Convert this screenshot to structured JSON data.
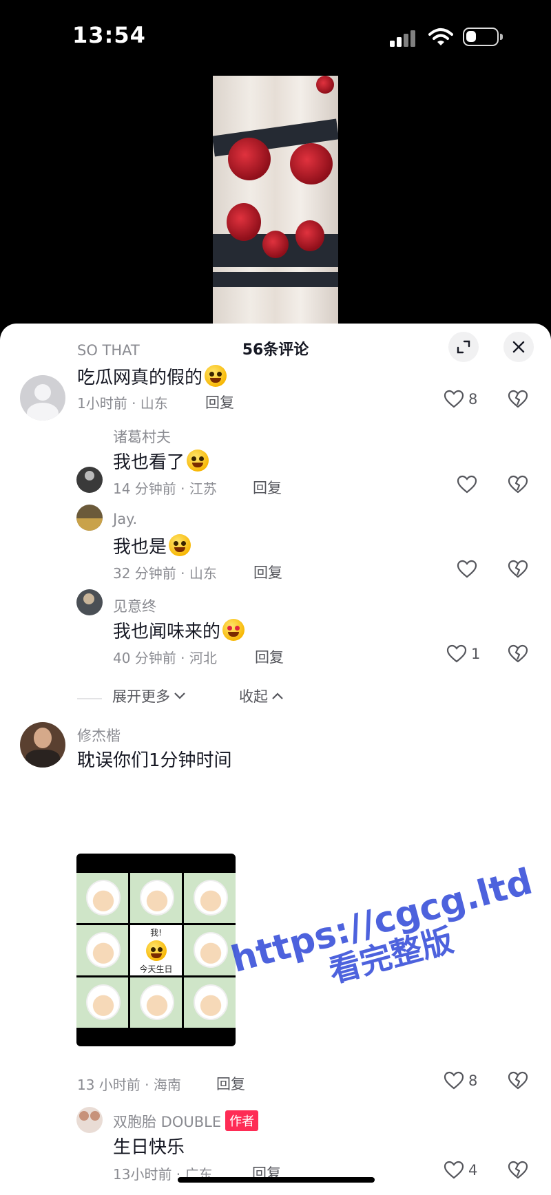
{
  "status_bar": {
    "time": "13:54"
  },
  "sheet": {
    "title": "56条评论"
  },
  "comments": [
    {
      "user": "SO THAT",
      "text": "吃瓜网真的假的",
      "meta": "1小时前 · 山东",
      "reply": "回复",
      "likes": "8"
    },
    {
      "user": "诸葛村夫",
      "text": "我也看了",
      "meta": "14 分钟前 · 江苏",
      "reply": "回复",
      "likes": ""
    },
    {
      "user": "Jay.",
      "text": "我也是",
      "meta": "32 分钟前 · 山东",
      "reply": "回复",
      "likes": ""
    },
    {
      "user": "见意终",
      "text": "我也闻味来的",
      "meta": "40 分钟前 · 河北",
      "reply": "回复",
      "likes": "1"
    },
    {
      "user": "修杰楷",
      "text": "耽误你们1分钟时间",
      "meta": "13 小时前 · 海南",
      "reply": "回复",
      "likes": "8"
    },
    {
      "user": "双胞胎 DOUBLE",
      "badge": "作者",
      "text": "生日快乐",
      "meta": "13小时前 · 广东",
      "reply": "回复",
      "likes": "4"
    }
  ],
  "thread": {
    "expand": "展开更多",
    "collapse": "收起"
  },
  "sticker": {
    "top_label": "我!",
    "bottom_label": "今天生日"
  },
  "watermark": {
    "line1": "https://cgcg.ltd",
    "line2": "看完整版"
  },
  "icons": [
    "signal-icon",
    "wifi-icon",
    "battery-icon",
    "expand-icon",
    "close-icon",
    "heart-icon",
    "broken-heart-icon",
    "chevron-down-icon",
    "chevron-up-icon"
  ]
}
